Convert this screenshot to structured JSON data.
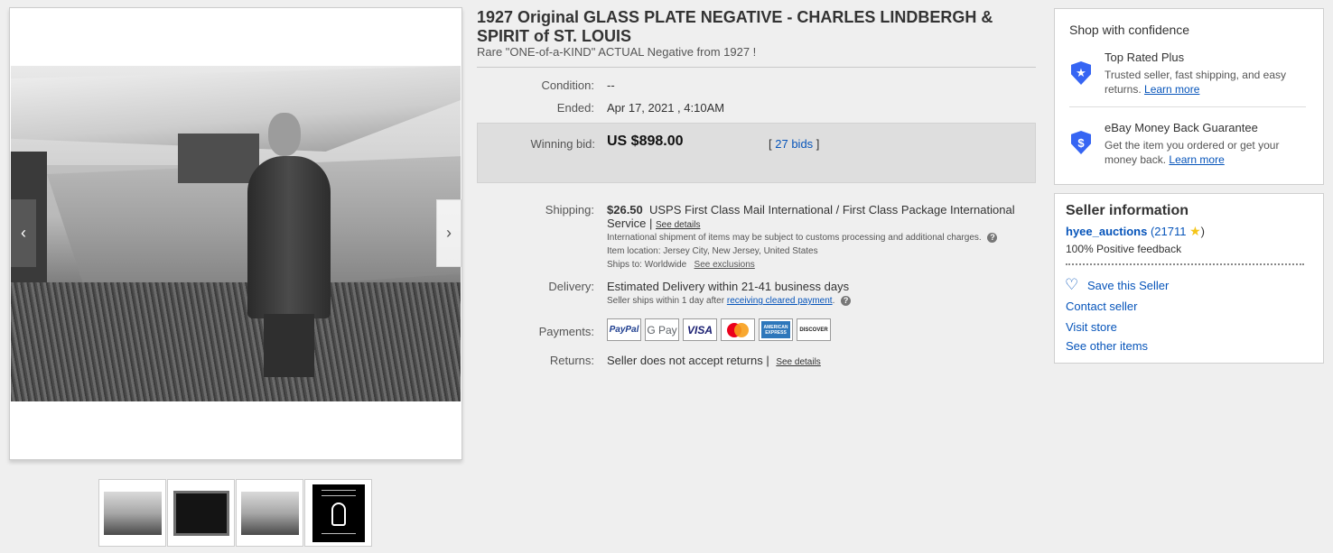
{
  "listing": {
    "title": "1927 Original GLASS PLATE NEGATIVE - CHARLES LINDBERGH & SPIRIT of ST. LOUIS",
    "subtitle": "Rare \"ONE-of-a-KIND\" ACTUAL Negative from 1927 !"
  },
  "details": {
    "condition_label": "Condition:",
    "condition_value": "--",
    "ended_label": "Ended:",
    "ended_value": "Apr 17, 2021 , 4:10AM",
    "winning_bid_label": "Winning bid:",
    "winning_bid_value": "US $898.00",
    "bids_prefix": "[",
    "bids_link": "27 bids",
    "bids_suffix": "]",
    "shipping_label": "Shipping:",
    "shipping_price": "$26.50",
    "shipping_service": "USPS First Class Mail International / First Class Package International",
    "shipping_service2": "Service",
    "shipping_sep": "|",
    "see_details": "See details",
    "intl_note": "International shipment of items may be subject to customs processing and additional charges.",
    "item_location": "Item location:  Jersey City, New Jersey, United States",
    "ships_to_label": "Ships to:  Worldwide",
    "see_exclusions": "See exclusions",
    "delivery_label": "Delivery:",
    "delivery_value": "Estimated Delivery within 21-41 business days",
    "handling_prefix": "Seller ships within 1 day after",
    "handling_link": "receiving cleared payment",
    "handling_suffix": ".",
    "payments_label": "Payments:",
    "returns_label": "Returns:",
    "returns_value": "Seller does not accept returns |",
    "returns_see_details": "See details"
  },
  "payments": {
    "paypal": "PayPal",
    "gpay": "G Pay",
    "visa": "VISA",
    "amex": "AMERICAN EXPRESS",
    "discover": "DISCOVER"
  },
  "shop_confidence": {
    "title": "Shop with confidence",
    "top_rated_title": "Top Rated Plus",
    "top_rated_desc": "Trusted seller, fast shipping, and easy returns.",
    "learn_more": "Learn more",
    "guarantee_title": "eBay Money Back Guarantee",
    "guarantee_desc": "Get the item you ordered or get your money back.",
    "guarantee_icon_glyph": "$"
  },
  "seller": {
    "title": "Seller information",
    "name": "hyee_auctions",
    "score": "(21711",
    "score_close": ")",
    "star": "★",
    "feedback": "100% Positive feedback",
    "save": "Save this Seller",
    "contact": "Contact seller",
    "visit": "Visit store",
    "other": "See other items"
  },
  "gallery": {
    "prev": "‹",
    "next": "›"
  },
  "colors": {
    "link": "#0654ba",
    "shield": "#3665f3",
    "star": "#f5c518"
  }
}
